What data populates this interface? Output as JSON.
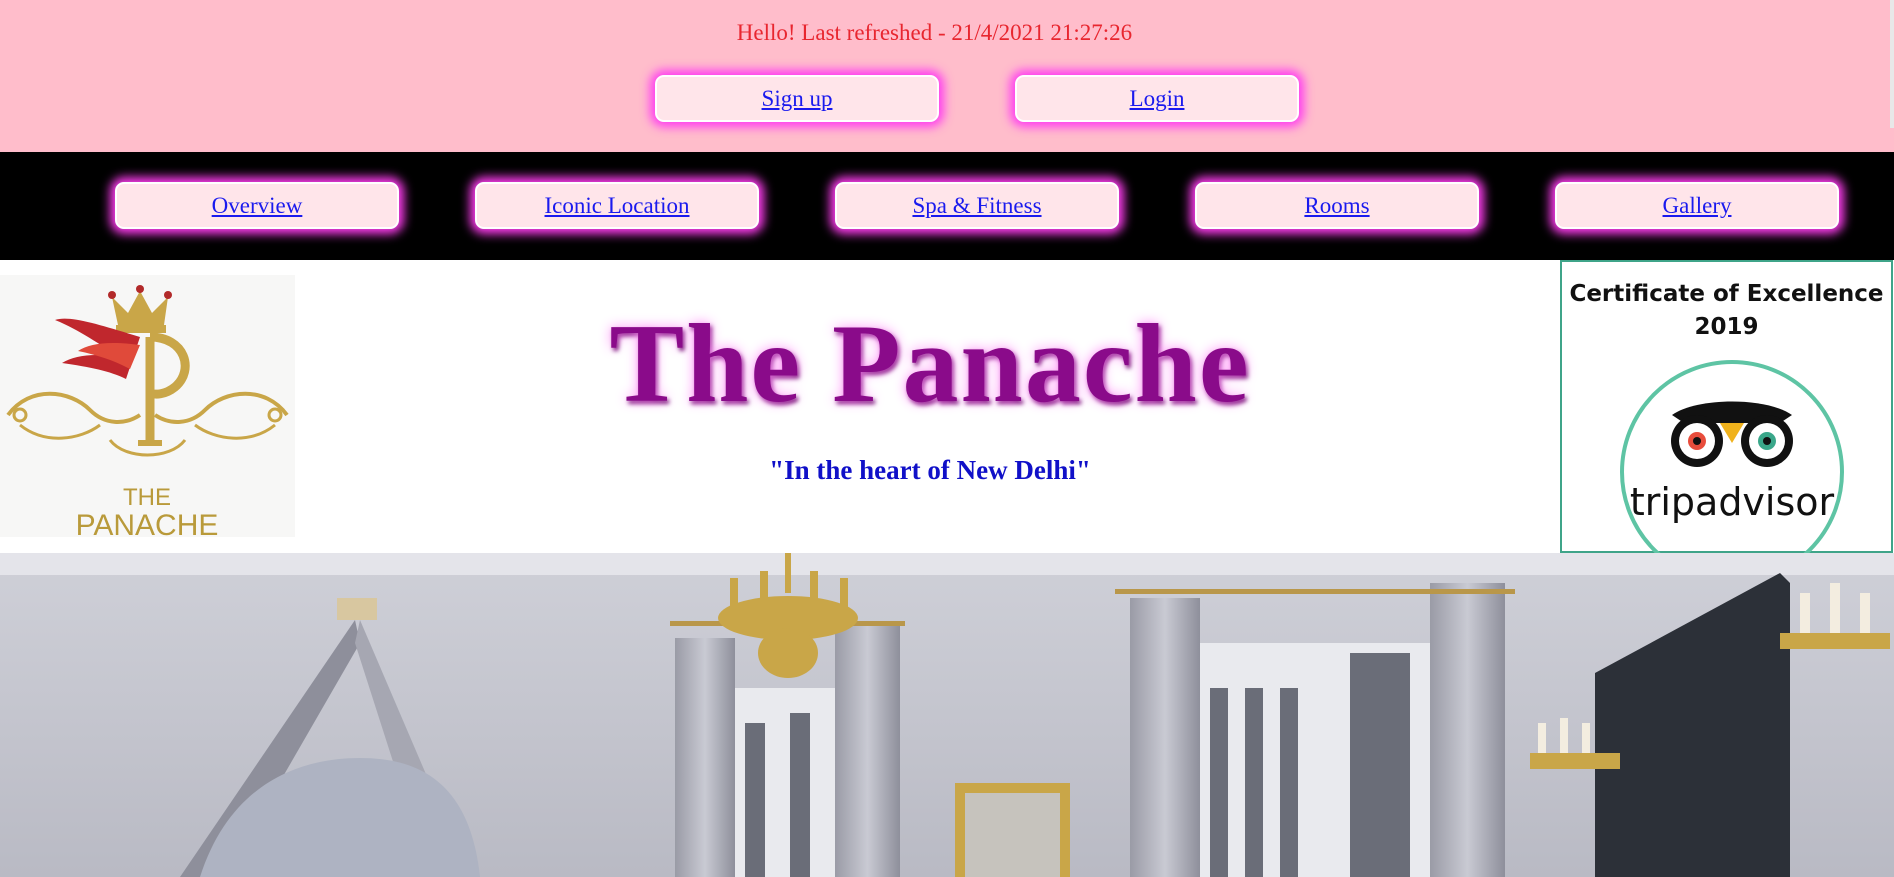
{
  "top": {
    "greeting": "Hello! Last refreshed - 21/4/2021 21:27:26",
    "signup_label": "Sign up",
    "login_label": "Login",
    "background": "#ffbdcb",
    "greeting_color": "#e8262f",
    "glow_color": "#ff3df0"
  },
  "nav": {
    "items": [
      {
        "label": "Overview"
      },
      {
        "label": "Iconic Location"
      },
      {
        "label": "Spa & Fitness"
      },
      {
        "label": "Rooms"
      },
      {
        "label": "Gallery"
      }
    ],
    "background": "#000000"
  },
  "header": {
    "title": "The Panache",
    "tagline": "\"In the heart of New Delhi\"",
    "title_color": "#8a0b8a",
    "tagline_color": "#1010c8"
  },
  "logo": {
    "icon": "crown-p-monogram-icon",
    "line1": "THE",
    "line2": "PANACHE"
  },
  "certificate": {
    "line1": "Certificate of Excellence",
    "line2": "2019",
    "brand": "tripadvisor",
    "icon": "owl-icon",
    "border_color": "#3fa489"
  },
  "hero": {
    "icon": "hotel-room-photo"
  }
}
